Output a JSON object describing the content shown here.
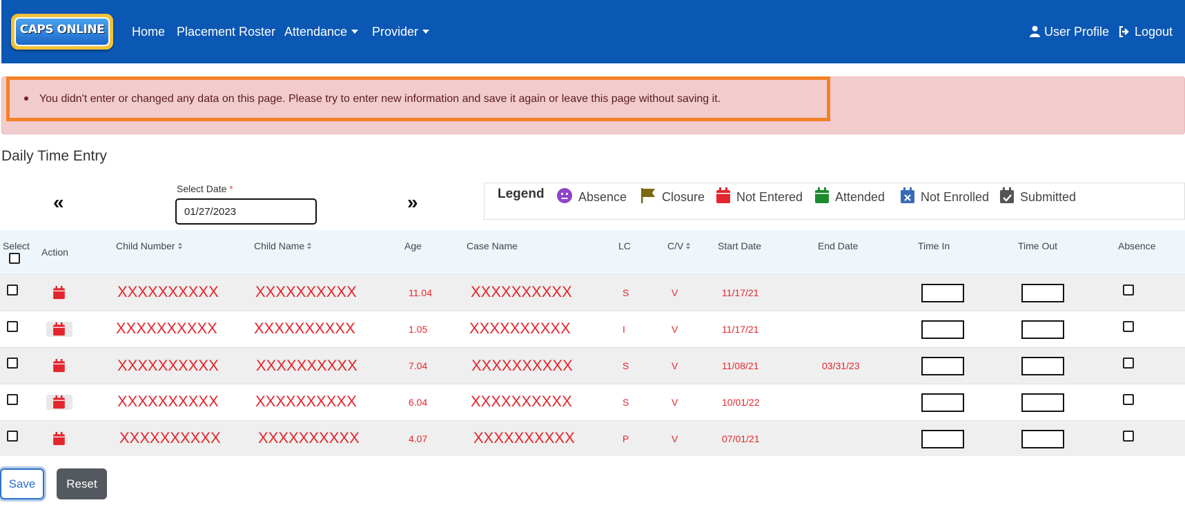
{
  "navbar": {
    "logo_text": "CAPS ONLINE",
    "links": [
      {
        "label": "Home",
        "dropdown": false
      },
      {
        "label": "Placement Roster",
        "dropdown": false
      },
      {
        "label": "Attendance",
        "dropdown": true
      },
      {
        "label": "Provider",
        "dropdown": true
      }
    ],
    "user_profile": "User Profile",
    "logout": "Logout",
    "bg_color": "#0b57b4"
  },
  "alert": {
    "message": "You didn't enter or changed any data on this page. Please try to enter new information and save it again or leave this page without saving it.",
    "bg_color": "#f2cccd",
    "highlight_color": "#f48028"
  },
  "page_title": "Daily Time Entry",
  "date_picker": {
    "prev_label": "«",
    "next_label": "»",
    "label": "Select Date",
    "required_mark": "*",
    "value": "01/27/2023"
  },
  "legend": {
    "title": "Legend",
    "items": [
      {
        "label": "Absence",
        "icon": "absence-face-icon",
        "color": "#8e44c8"
      },
      {
        "label": "Closure",
        "icon": "flag-icon",
        "color": "#7a6a10"
      },
      {
        "label": "Not Entered",
        "icon": "calendar-icon",
        "color": "#e3262d"
      },
      {
        "label": "Attended",
        "icon": "calendar-icon",
        "color": "#1e8a2e"
      },
      {
        "label": "Not Enrolled",
        "icon": "calendar-x-icon",
        "color": "#3a6bb8"
      },
      {
        "label": "Submitted",
        "icon": "calendar-check-icon",
        "color": "#555555"
      }
    ]
  },
  "table": {
    "headers": {
      "select": "Select",
      "action": "Action",
      "child_number": "Child Number",
      "child_name": "Child Name",
      "age": "Age",
      "case_name": "Case Name",
      "lc": "LC",
      "cv": "C/V",
      "start_date": "Start Date",
      "end_date": "End Date",
      "time_in": "Time In",
      "time_out": "Time Out",
      "absence": "Absence"
    },
    "rows": [
      {
        "child_number": "XXXXXXXXXX",
        "child_name": "XXXXXXXXXX",
        "age": "11.04",
        "case_name": "XXXXXXXXXX",
        "lc": "S",
        "cv": "V",
        "start_date": "11/17/21",
        "end_date": "",
        "action_status": "not-entered"
      },
      {
        "child_number": "XXXXXXXXXX",
        "child_name": "XXXXXXXXXX",
        "age": "1.05",
        "case_name": "XXXXXXXXXX",
        "lc": "I",
        "cv": "V",
        "start_date": "11/17/21",
        "end_date": "",
        "action_status": "not-entered"
      },
      {
        "child_number": "XXXXXXXXXX",
        "child_name": "XXXXXXXXXX",
        "age": "7.04",
        "case_name": "XXXXXXXXXX",
        "lc": "S",
        "cv": "V",
        "start_date": "11/08/21",
        "end_date": "03/31/23",
        "action_status": "not-entered"
      },
      {
        "child_number": "XXXXXXXXXX",
        "child_name": "XXXXXXXXXX",
        "age": "6.04",
        "case_name": "XXXXXXXXXX",
        "lc": "S",
        "cv": "V",
        "start_date": "10/01/22",
        "end_date": "",
        "action_status": "not-entered"
      },
      {
        "child_number": "XXXXXXXXXX",
        "child_name": "XXXXXXXXXX",
        "age": "4.07",
        "case_name": "XXXXXXXXXX",
        "lc": "P",
        "cv": "V",
        "start_date": "07/01/21",
        "end_date": "",
        "action_status": "not-entered"
      }
    ],
    "row_text_color": "#e3262d"
  },
  "buttons": {
    "save": "Save",
    "reset": "Reset"
  }
}
